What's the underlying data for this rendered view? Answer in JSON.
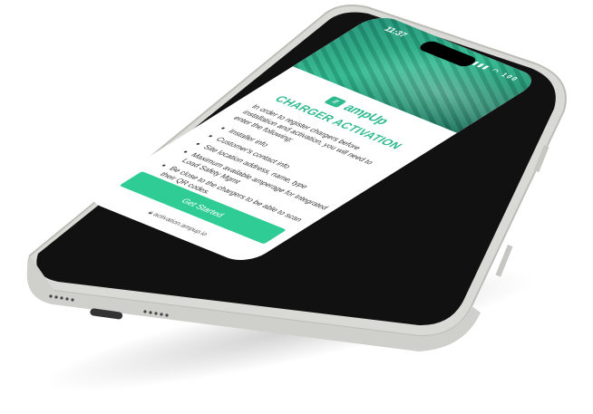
{
  "status_bar": {
    "time": "11:37",
    "icons": [
      "signal-icon",
      "wifi-icon",
      "battery-icon"
    ],
    "battery": "100"
  },
  "brand": {
    "logo_mark": "//",
    "name": "ampUp",
    "accent": "#2fb98e"
  },
  "page": {
    "title": "CHARGER ACTIVATION",
    "intro": "In order to register chargers before installation and activation, you will need to enter the following:",
    "items": [
      "Installer info",
      "Customer's contact info",
      "Site location address, name, type",
      "Maximum available amperage for Integrated Load Safety Mgmt",
      "Be close to the chargers to be able to scan their QR codes."
    ],
    "cta_label": "Get Started",
    "url": "activation.ampup.io"
  }
}
